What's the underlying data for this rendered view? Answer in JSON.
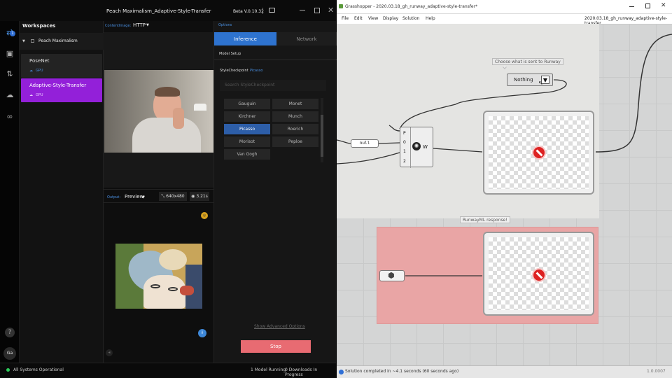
{
  "runway": {
    "title": "Peach Maximalism_Adaptive-Style-Transfer",
    "version": "Beta V.0.10.32",
    "sidebar": {
      "header": "Workspaces",
      "workspace": "Peach Maximalism",
      "models": [
        {
          "name": "PoseNet",
          "tag": "GPU"
        },
        {
          "name": "Adaptive-Style-Transfer",
          "tag": "GPU"
        }
      ]
    },
    "avatar": "Ga",
    "input": {
      "label": "ContentImage:",
      "value": "HTTP"
    },
    "output": {
      "label": "Output:",
      "mode": "Preview",
      "size": "640x480",
      "time": "3.21s"
    },
    "options": {
      "label": "Options",
      "tabs": [
        "Inference",
        "Network"
      ],
      "section": "Model Setup",
      "field_label": "StyleCheckpoint",
      "field_value": "Picasso",
      "search_placeholder": "Search StyleCheckpoint",
      "styles": [
        "Gauguin",
        "Monet",
        "Kirchner",
        "Munch",
        "Picasso",
        "Roerich",
        "Morisot",
        "Peploe",
        "Van Gogh"
      ],
      "advanced": "Show Advanced Options",
      "stop": "Stop"
    },
    "status": {
      "left": "All Systems Operational",
      "running": "1 Model Running",
      "downloads": "0 Downloads In Progress"
    },
    "colors": {
      "accent": "#9320d9",
      "active_style": "#2d5ea8",
      "stop": "#e86b72"
    }
  },
  "grasshopper": {
    "title": "Grasshopper - 2020.03.18_gh_runway_adaptive-style-transfer*",
    "menu": [
      "File",
      "Edit",
      "View",
      "Display",
      "Solution",
      "Help"
    ],
    "doc_tab": "2020.03.18_gh_runway_adaptive-style-transfer",
    "tooltip": "Choose what is sent to Runway",
    "dropdown": "Nothing",
    "panel_value": "null",
    "component": {
      "inputs": [
        "P",
        "0",
        "1",
        "2"
      ],
      "output": "W"
    },
    "group_label": "RunwayML response!",
    "status": "Solution completed in ~4.1 seconds (60 seconds ago)",
    "version": "1.0.0007"
  }
}
